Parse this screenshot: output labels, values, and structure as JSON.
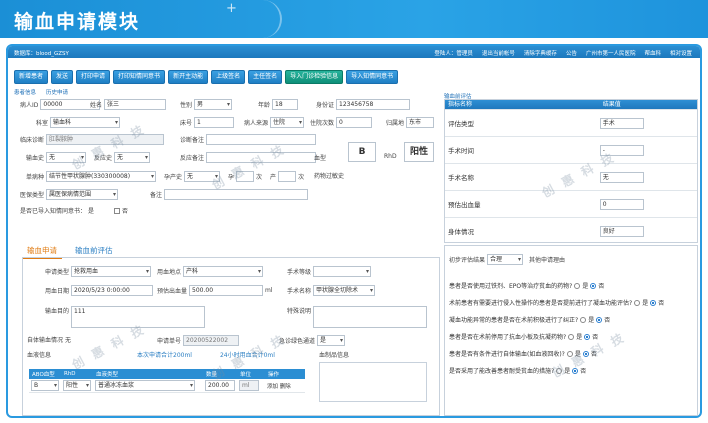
{
  "banner": {
    "title": "输血申请模块"
  },
  "topbar": {
    "db": "数据库：blood_GZSY",
    "links": [
      "登陆人：管理员",
      "退出当前帐号",
      "清除字典缓存",
      "公告",
      "广州市第一人民医院",
      "帮血科",
      "相对设置"
    ]
  },
  "toolbar": {
    "buttons": [
      {
        "label": "新增患者",
        "green": false
      },
      {
        "label": "发送",
        "green": false
      },
      {
        "label": "打印申请",
        "green": false
      },
      {
        "label": "打印知情同意书",
        "green": false
      },
      {
        "label": "新开主动能",
        "green": false
      },
      {
        "label": "上级签名",
        "green": false
      },
      {
        "label": "主任签名",
        "green": false
      },
      {
        "label": "导入门诊检验信息",
        "green": true
      },
      {
        "label": "导入知情同意书",
        "green": false
      }
    ]
  },
  "subtabs": [
    "患者信息",
    "历史申请"
  ],
  "patient": {
    "id_label": "病人ID",
    "id_value": "00000",
    "name_label": "姓名",
    "name_value": "张三",
    "sex_label": "性别",
    "sex_value": "男",
    "age_label": "年龄",
    "age_value": "18",
    "idcard_label": "身份证",
    "idcard_value": "123456758",
    "dept_label": "科室",
    "dept_value": "输血科",
    "bed_label": "床号",
    "bed_value": "1",
    "source_label": "病人来源",
    "source_value": "住院",
    "times_label": "住院次数",
    "times_value": "0",
    "type_label": "归属地",
    "type_value": "东市",
    "diag_label": "临床诊断",
    "diag_value": "肛裂脓肿",
    "diag_note_label": "诊断备注",
    "history_label": "输血史",
    "history_value": "无",
    "reaction_label": "反应史",
    "reaction_value": "无",
    "reaction_note_label": "反应备注",
    "blood_type_label": "血型",
    "blood_type_value": "B",
    "rhd_label": "RhD",
    "rhd_value": "阳性",
    "unit_label": "单病种",
    "unit_value": "结节性甲状腺肿(330300008)",
    "preg_label": "孕产史",
    "preg_value": "无",
    "preg2": "孕",
    "times1": "次",
    "birth": "产",
    "times2": "次",
    "allergy_label": "药物过敏史",
    "insurance_label": "医保类型",
    "insurance_value": "属医保病情范围",
    "remark_label": "备注",
    "consent_label": "是否已导入知情同意书：",
    "consent_value": "是",
    "consent_no": "否"
  },
  "right_table": {
    "title": "输血前评估",
    "col1": "指标名称",
    "col2": "结果值",
    "rows": [
      {
        "k": "评估类型",
        "v": "手术"
      },
      {
        "k": "手术时间",
        "v": "-"
      },
      {
        "k": "手术名称",
        "v": "无"
      },
      {
        "k": "预估出血量",
        "v": "0"
      },
      {
        "k": "身体情况",
        "v": "良好"
      }
    ]
  },
  "tabs": [
    "输血申请",
    "输血前评估"
  ],
  "apply": {
    "apply_type_label": "申请类型",
    "apply_type_value": "抢救用血",
    "place_label": "用血地点",
    "place_value": "产科",
    "level_label": "手术等级",
    "date_label": "用血日期",
    "date_value": "2020/5/23 0:00:00",
    "volume_label": "预估出血量",
    "volume_value": "500.00",
    "ml": "ml",
    "op_label": "手术名称",
    "op_value": "甲状腺全切除术",
    "purpose_label": "输血目的",
    "purpose_value": "111",
    "special_label": "特殊说明",
    "autolog_label": "自体输血情况",
    "autolog_value": "无",
    "apply_no_label": "申请单号",
    "apply_no_value": "20200522002",
    "green_label": "急诊绿色通道",
    "green_value": "是",
    "blood_info_label": "血液信息",
    "week_total": "本次申请合计200ml",
    "day_total": "24小时用血合计0ml",
    "blood_msg_label": "血制品信息",
    "table_headers": [
      "ABO血型",
      "RhD",
      "血液类型",
      "数量",
      "单位",
      "操作"
    ],
    "table_row": {
      "abo": "B",
      "rhd": "阳性",
      "type": "普通冰冻血浆",
      "qty": "200.00",
      "unit": "ml",
      "ops": "添加 删除"
    }
  },
  "eval": {
    "result_label": "初步评估结果",
    "result_value": "合理",
    "other_label": "其他申请理由",
    "questions": [
      {
        "q": "患者是否使用过铁剂、EPO等治疗贫血的药物?",
        "yes": "是",
        "no": "否",
        "sel": "no"
      },
      {
        "q": "术前患者有需要进行侵入性操作的患者是否提前进行了凝血功能评估?",
        "yes": "是",
        "no": "否",
        "sel": "no"
      },
      {
        "q": "凝血功能异常的患者是否在术前积极进行了纠正?",
        "yes": "是",
        "no": "否",
        "sel": "no"
      },
      {
        "q": "患者是否在术前停用了抗血小板及抗凝药物?",
        "yes": "是",
        "no": "否",
        "sel": "no"
      },
      {
        "q": "患者是否有条件进行自体输血(如血液回收)?",
        "yes": "是",
        "no": "否",
        "sel": "no"
      },
      {
        "q": "是否采用了能改善患者耐受贫血的措施?",
        "yes": "是",
        "no": "否",
        "sel": "no"
      }
    ]
  },
  "watermark": "创 惠 科 技"
}
